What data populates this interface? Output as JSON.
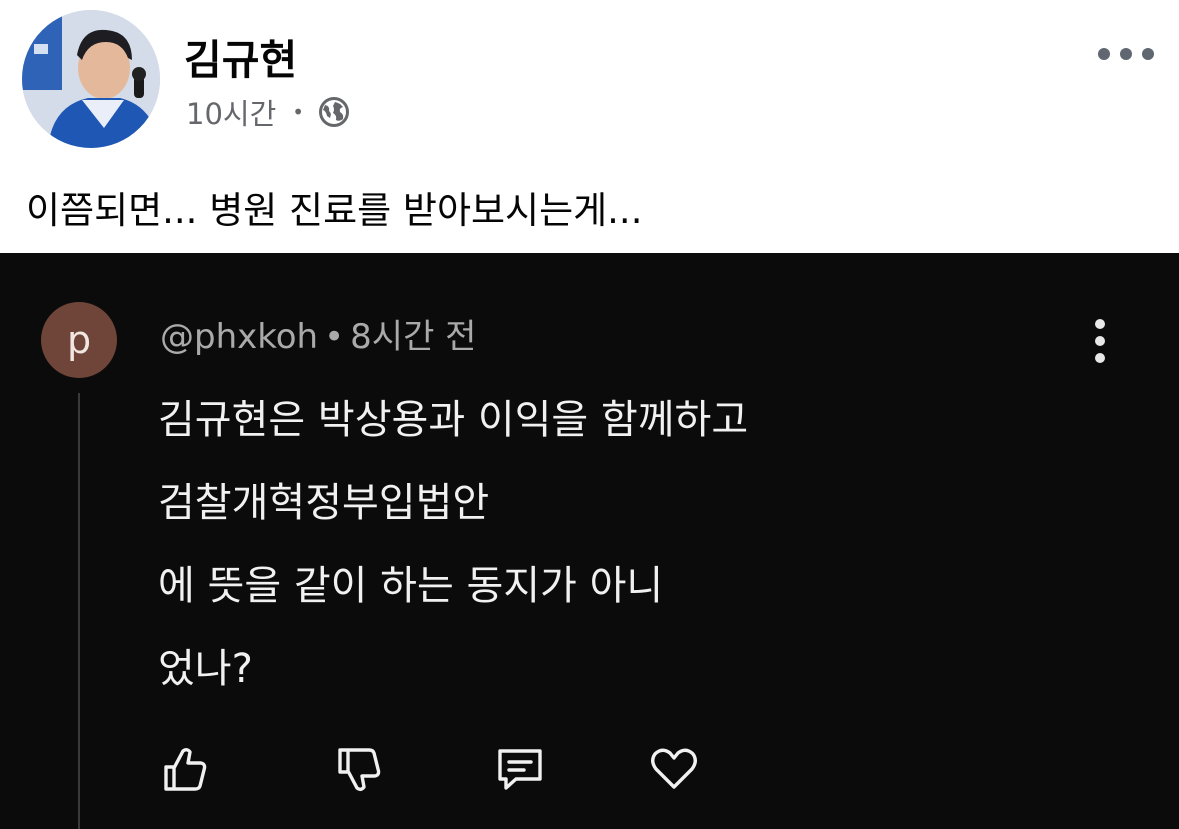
{
  "post": {
    "author": "김규현",
    "time": "10시간",
    "separator": "•",
    "privacy_icon": "globe-icon",
    "more_icon": "more-horizontal-icon",
    "text": "이쯤되면... 병원 진료를 받아보시는게..."
  },
  "screenshot": {
    "comment": {
      "avatar_letter": "p",
      "username": "@phxkoh",
      "separator": "•",
      "time": "8시간 전",
      "lines": [
        "김규현은 박상용과 이익을 함께하고",
        "검찰개혁정부입법안",
        "에 뜻을 같이 하는 동지가 아니",
        "었나?"
      ],
      "actions": [
        "thumbs-up-icon",
        "thumbs-down-icon",
        "reply-icon",
        "heart-icon"
      ]
    }
  },
  "colors": {
    "background": "#ffffff",
    "screenshot_background": "#0b0b0b",
    "comment_avatar": "#6e4538",
    "meta_text": "#65676b"
  }
}
